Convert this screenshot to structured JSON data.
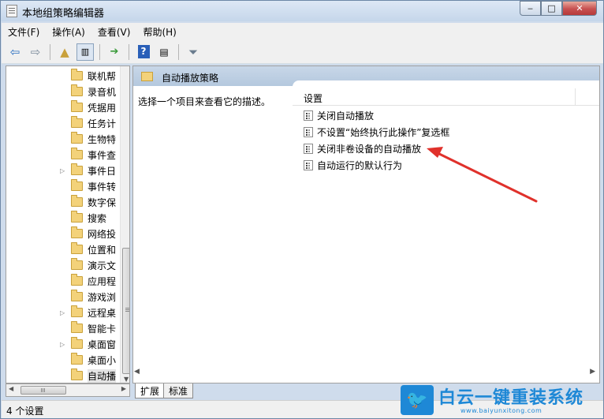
{
  "window": {
    "title": "本地组策略编辑器",
    "caption_minimize": "‒",
    "caption_maximize": "□",
    "caption_close": "✕"
  },
  "menu": [
    "文件(F)",
    "操作(A)",
    "查看(V)",
    "帮助(H)"
  ],
  "toolbar": {
    "icons": [
      "back-arrow",
      "forward-arrow",
      "up-folder",
      "show-hide-tree",
      "export-list",
      "help",
      "properties",
      "filter"
    ]
  },
  "tree": {
    "items": [
      {
        "label": "联机帮",
        "expandable": false
      },
      {
        "label": "录音机",
        "expandable": false
      },
      {
        "label": "凭据用",
        "expandable": false
      },
      {
        "label": "任务计",
        "expandable": false
      },
      {
        "label": "生物特",
        "expandable": false
      },
      {
        "label": "事件查",
        "expandable": false
      },
      {
        "label": "事件日",
        "expandable": true
      },
      {
        "label": "事件转",
        "expandable": false
      },
      {
        "label": "数字保",
        "expandable": false
      },
      {
        "label": "搜索",
        "expandable": false
      },
      {
        "label": "网络投",
        "expandable": false
      },
      {
        "label": "位置和",
        "expandable": false
      },
      {
        "label": "演示文",
        "expandable": false
      },
      {
        "label": "应用程",
        "expandable": false
      },
      {
        "label": "游戏浏",
        "expandable": false
      },
      {
        "label": "远程桌",
        "expandable": true
      },
      {
        "label": "智能卡",
        "expandable": false
      },
      {
        "label": "桌面窗",
        "expandable": true
      },
      {
        "label": "桌面小",
        "expandable": false
      },
      {
        "label": "自动播",
        "expandable": false,
        "selected": true
      }
    ]
  },
  "details": {
    "header_title": "自动播放策略",
    "description": "选择一个项目来查看它的描述。",
    "column_header": "设置",
    "settings": [
      "关闭自动播放",
      "不设置“始终执行此操作”复选框",
      "关闭非卷设备的自动播放",
      "自动运行的默认行为"
    ]
  },
  "tabs": [
    "扩展",
    "标准"
  ],
  "status": "4 个设置",
  "watermark": {
    "title": "白云一键重装系统",
    "url": "www.baiyunxitong.com"
  },
  "colors": {
    "annotation_arrow": "#e0312b",
    "watermark_blue": "#1e88d6",
    "header_band": "#b9cce2"
  }
}
